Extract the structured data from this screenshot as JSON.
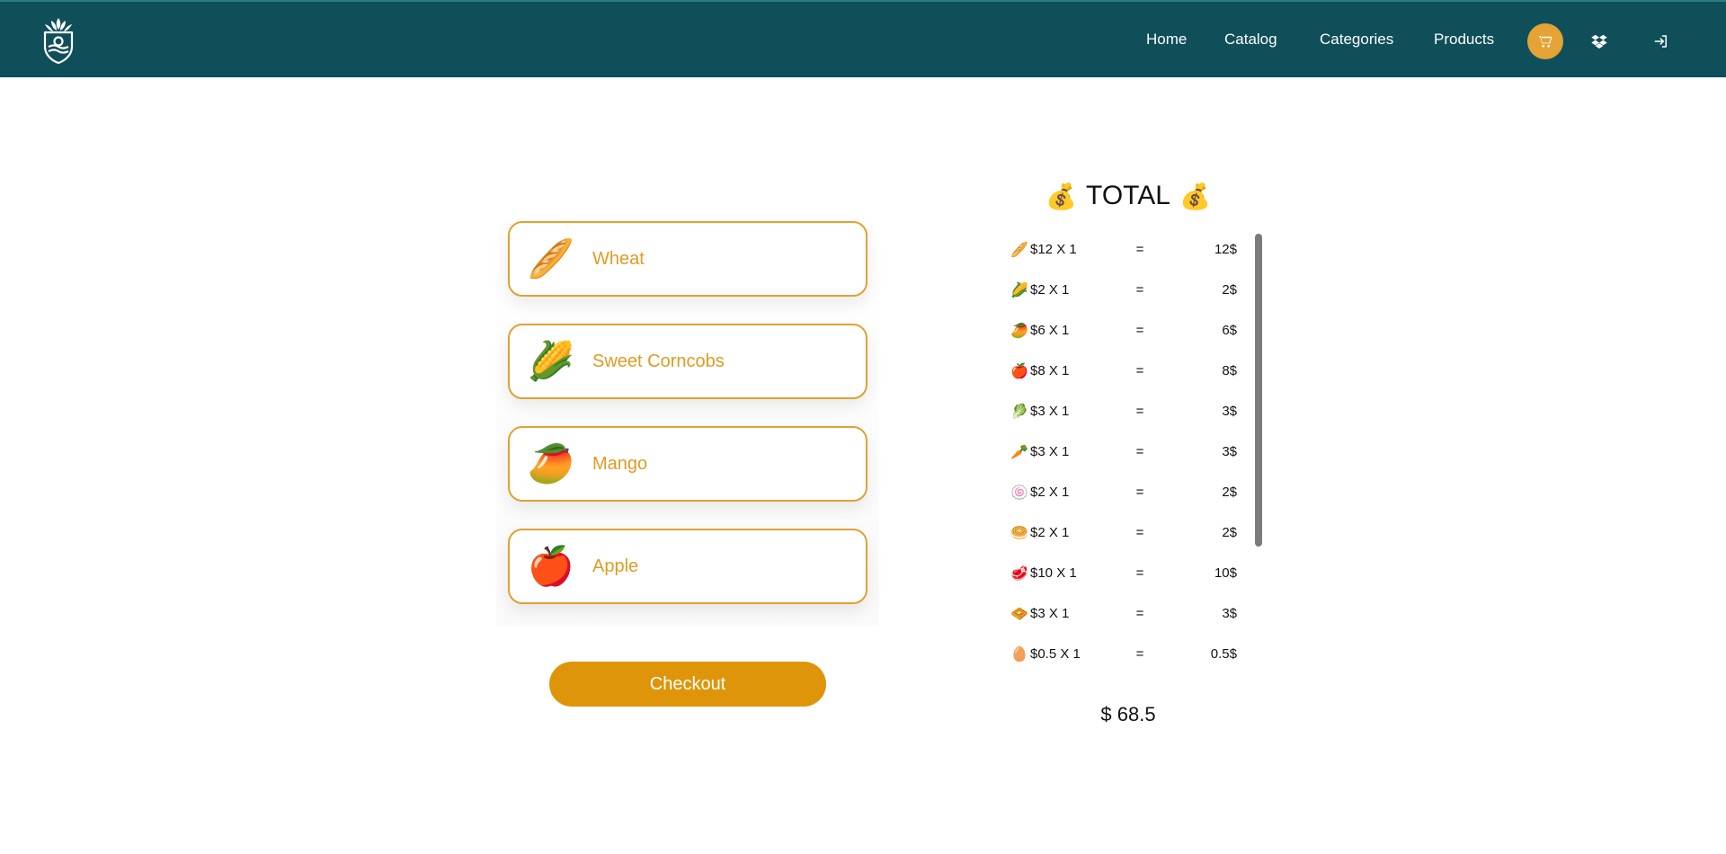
{
  "header": {
    "nav": [
      "Home",
      "Catalog",
      "Categories",
      "Products"
    ],
    "icons": [
      "cart-icon",
      "dropbox-icon",
      "logout-icon"
    ]
  },
  "cart_items": [
    {
      "emoji": "🥖",
      "name": "Wheat"
    },
    {
      "emoji": "🌽",
      "name": "Sweet Corncobs"
    },
    {
      "emoji": "🥭",
      "name": "Mango"
    },
    {
      "emoji": "🍎",
      "name": "Apple"
    }
  ],
  "checkout_label": "Checkout",
  "total": {
    "emoji_left": "💰",
    "title": "TOTAL",
    "emoji_right": "💰",
    "lines": [
      {
        "emoji": "🥖",
        "text": "$12 X 1",
        "eq": "=",
        "result": "12$"
      },
      {
        "emoji": "🌽",
        "text": "$2 X 1",
        "eq": "=",
        "result": "2$"
      },
      {
        "emoji": "🥭",
        "text": "$6 X 1",
        "eq": "=",
        "result": "6$"
      },
      {
        "emoji": "🍎",
        "text": "$8 X 1",
        "eq": "=",
        "result": "8$"
      },
      {
        "emoji": "🥬",
        "text": "$3 X 1",
        "eq": "=",
        "result": "3$"
      },
      {
        "emoji": "🥕",
        "text": "$3 X 1",
        "eq": "=",
        "result": "3$"
      },
      {
        "emoji": "🍥",
        "text": "$2 X 1",
        "eq": "=",
        "result": "2$"
      },
      {
        "emoji": "🥯",
        "text": "$2 X 1",
        "eq": "=",
        "result": "2$"
      },
      {
        "emoji": "🥩",
        "text": "$10 X 1",
        "eq": "=",
        "result": "10$"
      },
      {
        "emoji": "🧇",
        "text": "$3 X 1",
        "eq": "=",
        "result": "3$"
      },
      {
        "emoji": "🥚",
        "text": "$0.5 X 1",
        "eq": "=",
        "result": "0.5$"
      }
    ],
    "grand_total": "$ 68.5"
  },
  "colors": {
    "header_bg": "#0f4f5a",
    "accent": "#e09b23",
    "checkout": "#df950a",
    "cart_btn": "#e4a334"
  }
}
